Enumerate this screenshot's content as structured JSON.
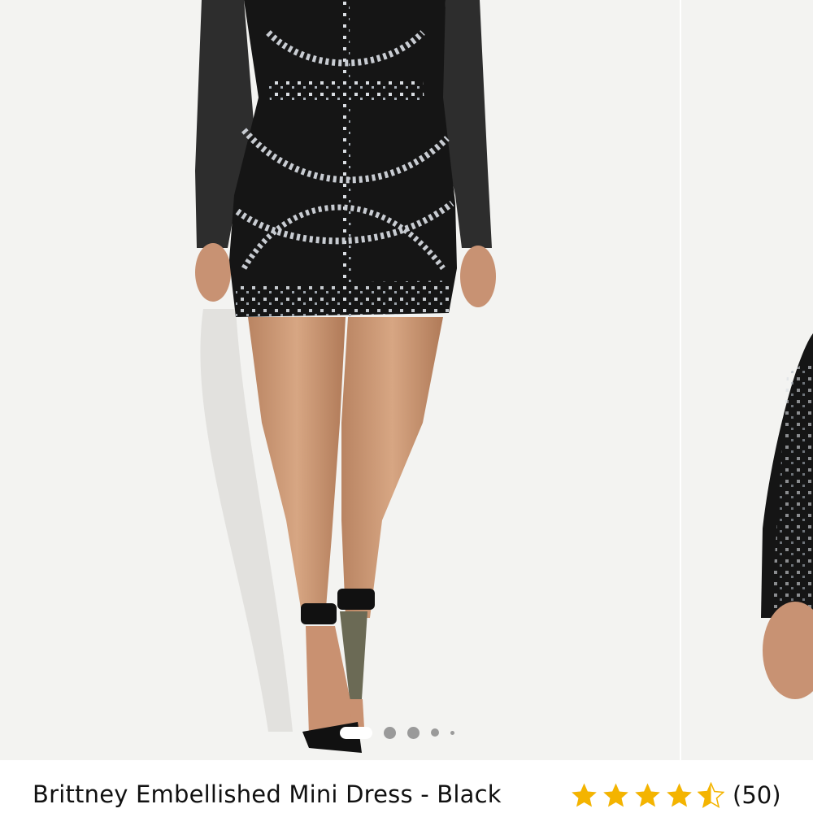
{
  "product": {
    "title": "Brittney Embellished Mini Dress - Black",
    "rating": 4.5,
    "rating_max": 5,
    "review_count": "(50)",
    "star_color": "#f4b400",
    "star_empty_color": "#d8d8d8"
  },
  "gallery": {
    "slide_count": 5,
    "active_slide": 1,
    "main_image": "product-photo",
    "next_image": "product-photo"
  },
  "colors": {
    "background": "#ffffff",
    "photo_background": "#f3f3f1",
    "dot_inactive": "#9a9a9a",
    "dot_active": "#ffffff"
  }
}
